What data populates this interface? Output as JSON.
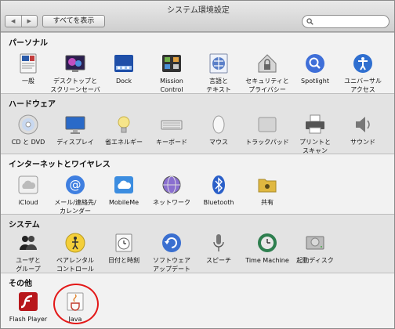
{
  "window": {
    "title": "システム環境設定"
  },
  "toolbar": {
    "back_label": "◀",
    "forward_label": "▶",
    "show_all_label": "すべてを表示",
    "search_value": ""
  },
  "sections": [
    {
      "title": "パーソナル",
      "items": [
        {
          "label": "一般",
          "icon": "general-icon"
        },
        {
          "label": "デスクトップと\nスクリーンセーバ",
          "icon": "desktop-screensaver-icon"
        },
        {
          "label": "Dock",
          "icon": "dock-icon"
        },
        {
          "label": "Mission\nControl",
          "icon": "mission-control-icon"
        },
        {
          "label": "言語と\nテキスト",
          "icon": "language-text-icon"
        },
        {
          "label": "セキュリティと\nプライバシー",
          "icon": "security-privacy-icon"
        },
        {
          "label": "Spotlight",
          "icon": "spotlight-icon"
        },
        {
          "label": "ユニバーサル\nアクセス",
          "icon": "universal-access-icon"
        }
      ]
    },
    {
      "title": "ハードウェア",
      "items": [
        {
          "label": "CD と DVD",
          "icon": "cd-dvd-icon"
        },
        {
          "label": "ディスプレイ",
          "icon": "display-icon"
        },
        {
          "label": "省エネルギー",
          "icon": "energy-saver-icon"
        },
        {
          "label": "キーボード",
          "icon": "keyboard-icon"
        },
        {
          "label": "マウス",
          "icon": "mouse-icon"
        },
        {
          "label": "トラックパッド",
          "icon": "trackpad-icon"
        },
        {
          "label": "プリントと\nスキャン",
          "icon": "print-scan-icon"
        },
        {
          "label": "サウンド",
          "icon": "sound-icon"
        }
      ]
    },
    {
      "title": "インターネットとワイヤレス",
      "items": [
        {
          "label": "iCloud",
          "icon": "icloud-icon"
        },
        {
          "label": "メール/連絡先/\nカレンダー",
          "icon": "mail-contacts-calendar-icon"
        },
        {
          "label": "MobileMe",
          "icon": "mobileme-icon"
        },
        {
          "label": "ネットワーク",
          "icon": "network-icon"
        },
        {
          "label": "Bluetooth",
          "icon": "bluetooth-icon"
        },
        {
          "label": "共有",
          "icon": "sharing-icon"
        }
      ]
    },
    {
      "title": "システム",
      "items": [
        {
          "label": "ユーザと\nグループ",
          "icon": "users-groups-icon"
        },
        {
          "label": "ペアレンタル\nコントロール",
          "icon": "parental-controls-icon"
        },
        {
          "label": "日付と時刻",
          "icon": "date-time-icon"
        },
        {
          "label": "ソフトウェア\nアップデート",
          "icon": "software-update-icon"
        },
        {
          "label": "スピーチ",
          "icon": "speech-icon"
        },
        {
          "label": "Time Machine",
          "icon": "time-machine-icon"
        },
        {
          "label": "起動ディスク",
          "icon": "startup-disk-icon"
        }
      ]
    },
    {
      "title": "その他",
      "items": [
        {
          "label": "Flash Player",
          "icon": "flash-player-icon"
        },
        {
          "label": "Java",
          "icon": "java-icon"
        }
      ]
    }
  ]
}
